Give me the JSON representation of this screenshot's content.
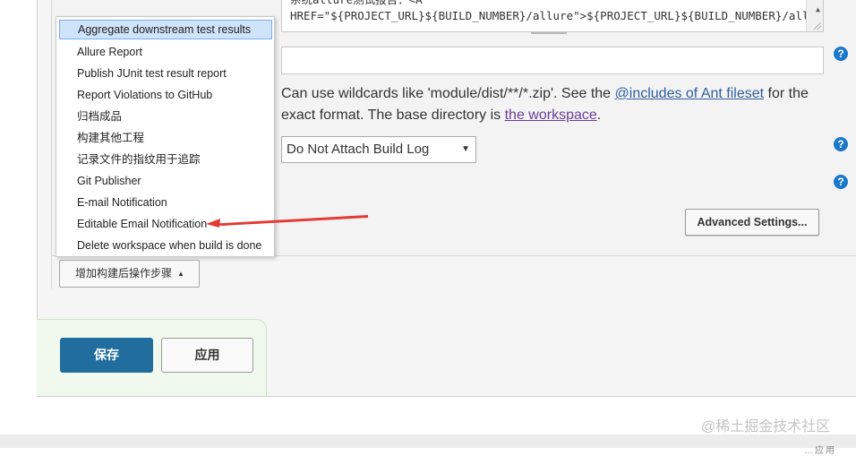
{
  "textarea": {
    "line1": "系统allure测试报告：<A",
    "line2": "HREF=\"${PROJECT_URL}${BUILD_NUMBER}/allure\">${PROJECT_URL}${BUILD_NUMBER}/allure"
  },
  "includes_field": {
    "value": ""
  },
  "description": {
    "part1": "Can use wildcards like 'module/dist/**/*.zip'. See the ",
    "link1": "@includes of Ant fileset",
    "part2": " for the exact format. The base directory is ",
    "link2": "the workspace",
    "part3": "."
  },
  "build_log_select": {
    "selected": "Do Not Attach Build Log"
  },
  "advanced_button": {
    "label": "Advanced Settings..."
  },
  "help_icon_glyph": "?",
  "dropdown": {
    "items": [
      "Aggregate downstream test results",
      "Allure Report",
      "Publish JUnit test result report",
      "Report Violations to GitHub",
      "归档成品",
      "构建其他工程",
      "记录文件的指纹用于追踪",
      "Git Publisher",
      "E-mail Notification",
      "Editable Email Notification",
      "Delete workspace when build is done"
    ],
    "highlighted_index": 0
  },
  "add_step_button": {
    "label": "增加构建后操作步骤"
  },
  "save_button": {
    "label": "保存"
  },
  "apply_button": {
    "label": "应用"
  },
  "watermark": {
    "text": "@稀土掘金技术社区",
    "cut_text": "…应用"
  },
  "colors": {
    "primary_button": "#216e9e",
    "help_icon": "#1a77c9",
    "highlight": "#cfe3fb",
    "arrow": "#e53935",
    "link": "#2f5f9e"
  }
}
